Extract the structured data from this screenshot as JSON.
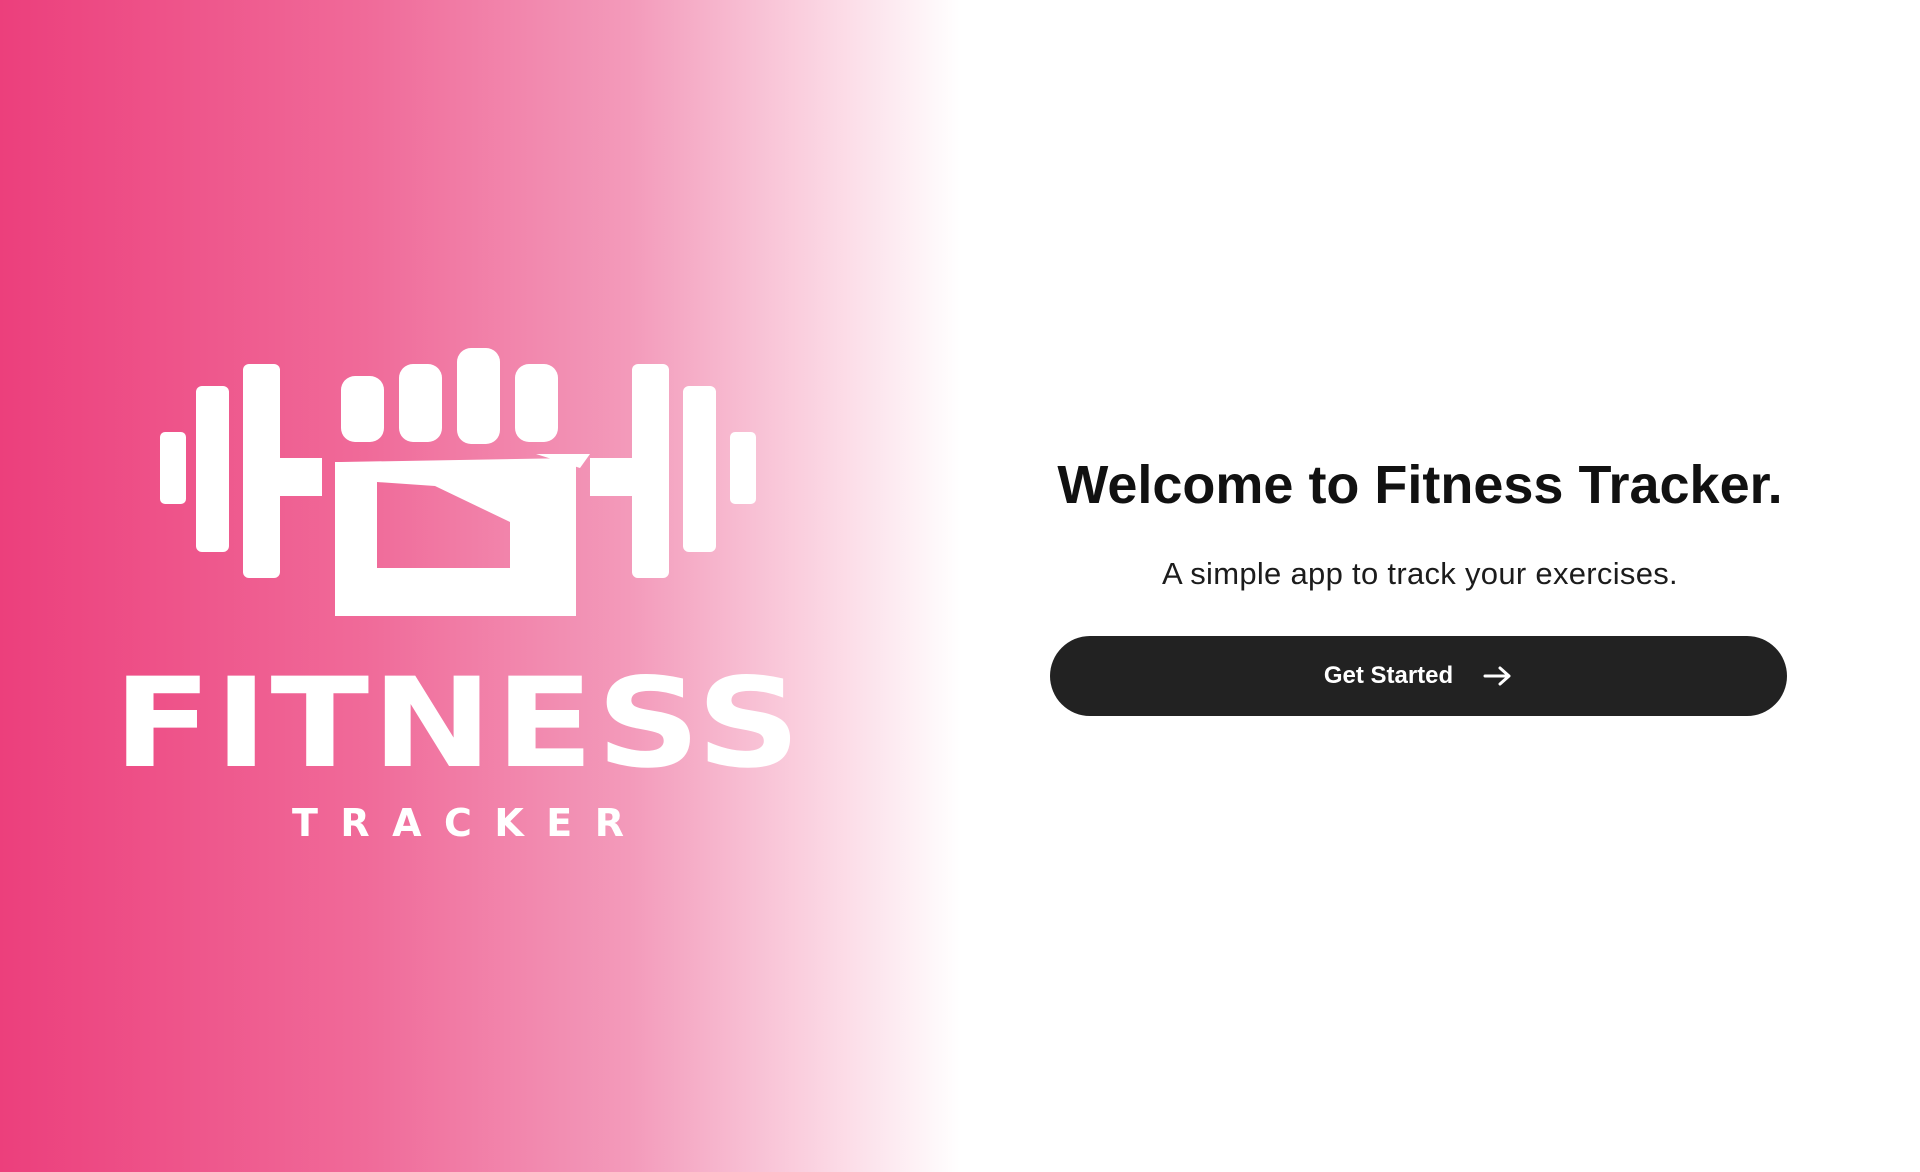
{
  "logo": {
    "name": "FITNESS TRACKER",
    "word_main": "FITNESS",
    "word_sub": "TRACKER",
    "icon": "fist-dumbbell-icon"
  },
  "welcome": {
    "title": "Welcome to Fitness Tracker.",
    "subtitle": "A simple app to track your exercises."
  },
  "cta": {
    "label": "Get Started",
    "icon": "arrow-right-icon"
  },
  "colors": {
    "brand_pink": "#ec3f7c",
    "button_dark": "#222222",
    "text_dark": "#111111",
    "background": "#ffffff"
  }
}
